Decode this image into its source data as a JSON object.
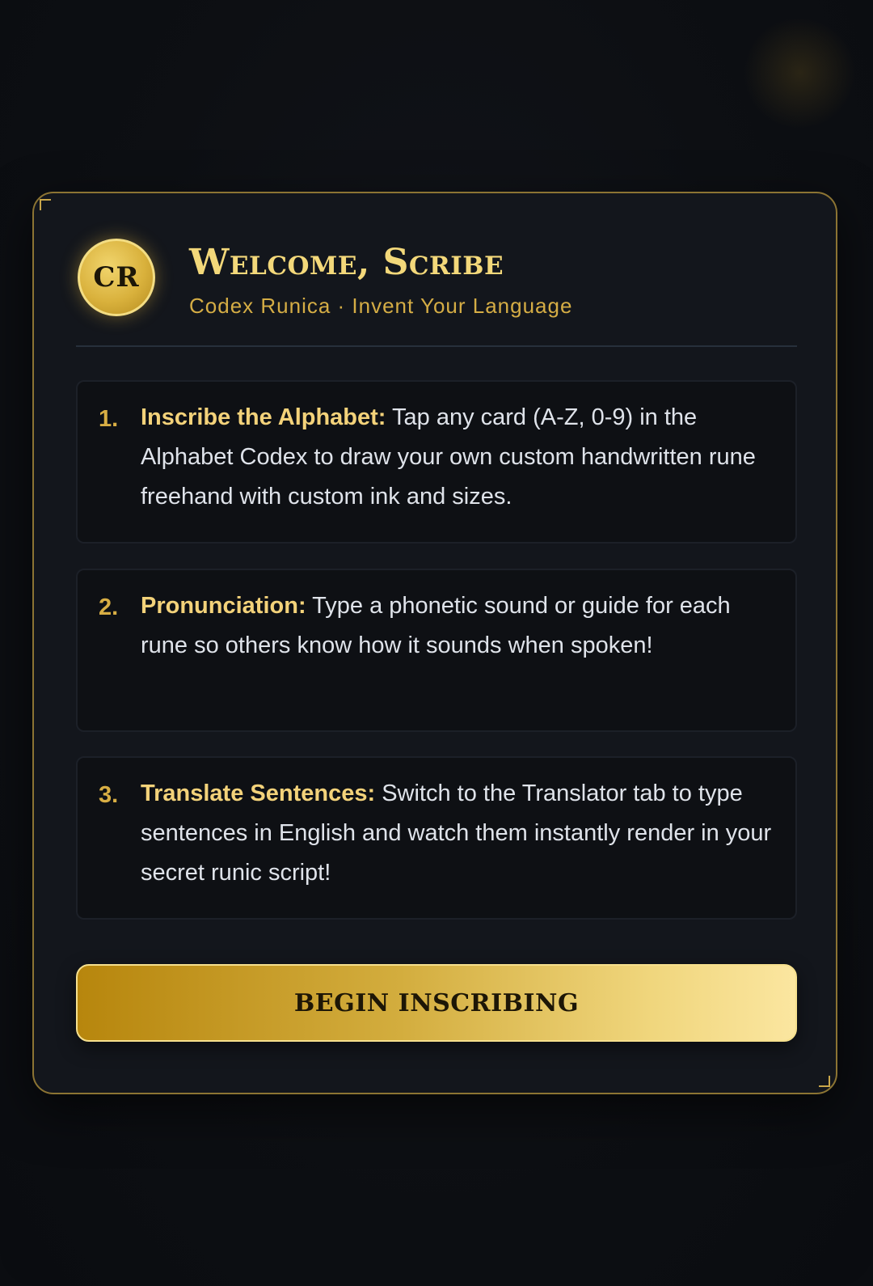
{
  "app": {
    "emblem_text": "CR",
    "title": "Welcome, Scribe",
    "subtitle": "Codex Runica · Invent Your Language"
  },
  "steps": [
    {
      "number": "1.",
      "lead": "Inscribe the Alphabet:",
      "body": " Tap any card (A-Z, 0-9) in the Alphabet Codex to draw your own custom handwritten rune freehand with custom ink and sizes."
    },
    {
      "number": "2.",
      "lead": "Pronunciation:",
      "body": " Type a phonetic sound or guide for each rune so others know how it sounds when spoken!"
    },
    {
      "number": "3.",
      "lead": "Translate Sentences:",
      "body": " Switch to the Translator tab to type sentences in English and watch them instantly render in your secret runic script!"
    }
  ],
  "cta": {
    "label": "BEGIN INSCRIBING"
  },
  "colors": {
    "accent_gold": "#d8ae44",
    "title_gold": "#f3d87a",
    "card_bg": "#13161c",
    "card_border": "#8c7433"
  }
}
